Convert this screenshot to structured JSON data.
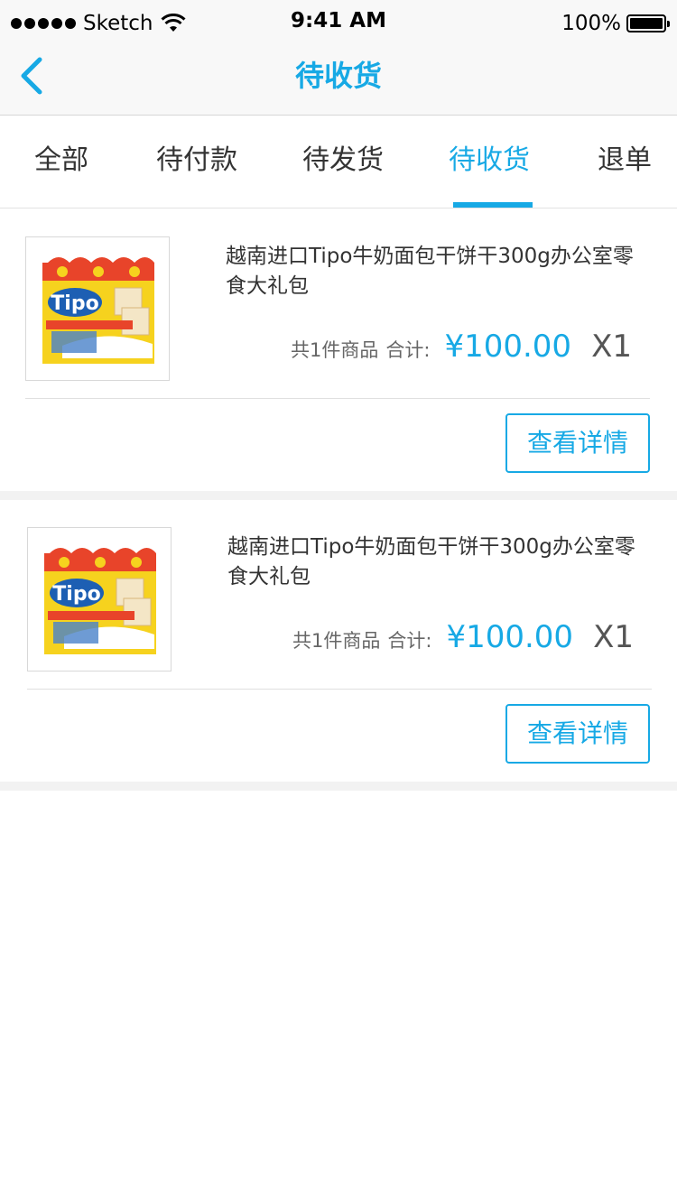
{
  "status_bar": {
    "carrier": "Sketch",
    "time": "9:41 AM",
    "battery": "100%"
  },
  "nav": {
    "title": "待收货",
    "back_icon": "chevron-left-icon"
  },
  "tabs": [
    {
      "label": "全部",
      "active": false
    },
    {
      "label": "待付款",
      "active": false
    },
    {
      "label": "待发货",
      "active": false
    },
    {
      "label": "待收货",
      "active": true
    },
    {
      "label": "退单",
      "active": false
    }
  ],
  "orders": [
    {
      "title": "越南进口Tipo牛奶面包干饼干300g办公室零食大礼包",
      "count": "共1件商品",
      "total_label": "合计:",
      "price": "¥100.00",
      "qty": "X1",
      "button": "查看详情",
      "product_logo": "Tipo"
    },
    {
      "title": "越南进口Tipo牛奶面包干饼干300g办公室零食大礼包",
      "count": "共1件商品",
      "total_label": "合计:",
      "price": "¥100.00",
      "qty": "X1",
      "button": "查看详情",
      "product_logo": "Tipo"
    }
  ],
  "colors": {
    "accent": "#17a9e5",
    "text": "#333333",
    "muted": "#666666",
    "separator": "#f2f2f2"
  }
}
